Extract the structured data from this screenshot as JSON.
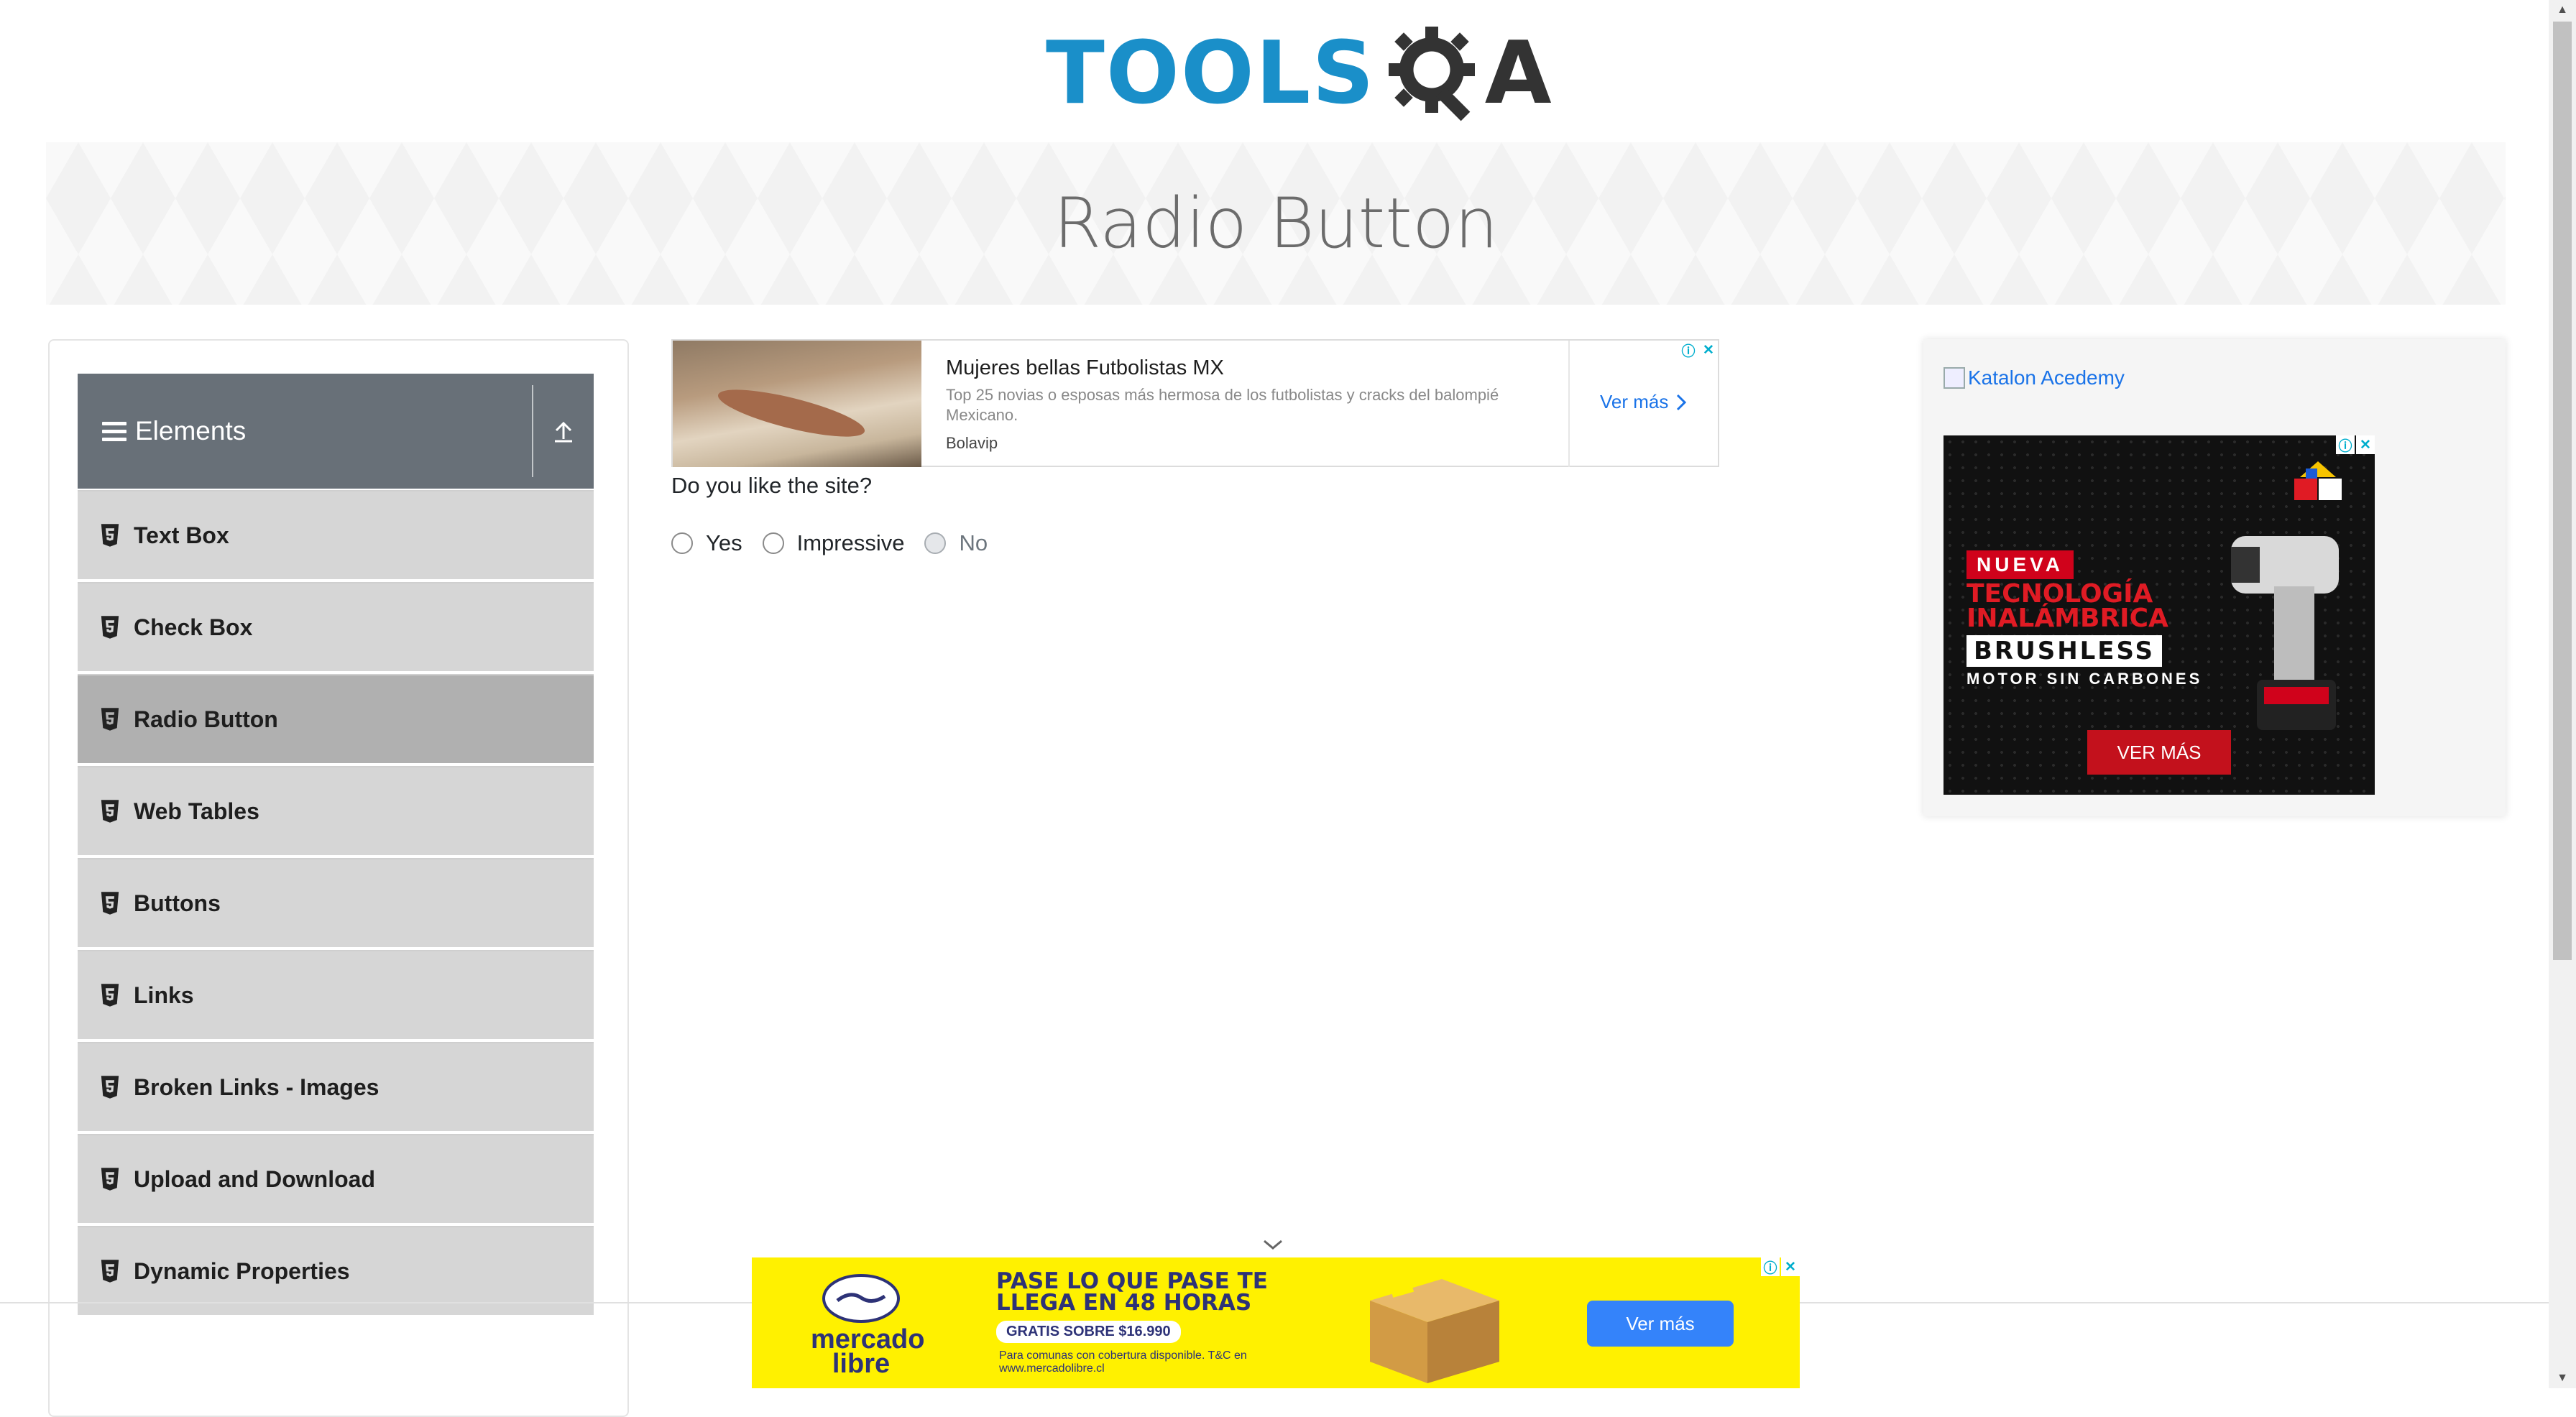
{
  "logo": {
    "text": "TOOLS",
    "suffix": "A"
  },
  "banner": {
    "title": "Radio Button"
  },
  "sidebar": {
    "group_title": "Elements",
    "items": [
      {
        "label": "Text Box",
        "active": false
      },
      {
        "label": "Check Box",
        "active": false
      },
      {
        "label": "Radio Button",
        "active": true
      },
      {
        "label": "Web Tables",
        "active": false
      },
      {
        "label": "Buttons",
        "active": false
      },
      {
        "label": "Links",
        "active": false
      },
      {
        "label": "Broken Links - Images",
        "active": false
      },
      {
        "label": "Upload and Download",
        "active": false
      },
      {
        "label": "Dynamic Properties",
        "active": false
      }
    ]
  },
  "top_ad": {
    "title": "Mujeres bellas Futbolistas MX",
    "description": "Top 25 novias o esposas más hermosa de los futbolistas y cracks del balompié Mexicano.",
    "source": "Bolavip",
    "cta": "Ver más"
  },
  "question": {
    "text": "Do you like the site?",
    "options": [
      {
        "label": "Yes",
        "disabled": false
      },
      {
        "label": "Impressive",
        "disabled": false
      },
      {
        "label": "No",
        "disabled": true
      }
    ]
  },
  "right_ad": {
    "link_text": "Katalon Acedemy",
    "nueva": "NUEVA",
    "tecnologia": "TECNOLOGÍA INALÁMBRICA",
    "brushless": "BRUSHLESS",
    "motor": "MOTOR SIN CARBONES",
    "cta": "VER MÁS"
  },
  "bottom_ad": {
    "brand": "mercado libre",
    "headline": "PASE LO QUE PASE TE LLEGA EN 48 HORAS",
    "gratis": "GRATIS SOBRE $16.990",
    "fine_print": "Para comunas con cobertura disponible. T&C en www.mercadolibre.cl",
    "cta": "Ver más"
  },
  "colors": {
    "logo_blue": "#1a8fc9",
    "group_header": "#687078",
    "menu_item": "#d6d6d6",
    "menu_item_active": "#b0b0b0",
    "ad_yellow": "#fff100",
    "ad_blue_button": "#3483fa"
  },
  "icons": {
    "menu": "hamburger-icon",
    "collapse": "arrow-up-icon",
    "item": "html5-shield-icon",
    "ad_info": "info-icon",
    "ad_close": "close-icon"
  }
}
